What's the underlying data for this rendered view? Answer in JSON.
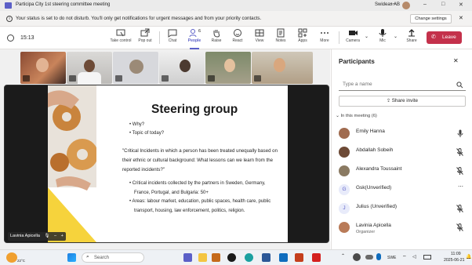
{
  "window": {
    "title": "Participa City 1st steering committee meeting",
    "org": "Swideas AB",
    "controls": [
      "minimize-icon",
      "maximize-icon",
      "close-icon"
    ]
  },
  "banner": {
    "message": "Your status is set to do not disturb. You'll only get notifications for urgent messages and from your priority contacts.",
    "button_label": "Change settings"
  },
  "toolbar": {
    "timer": "15:13",
    "take_control": "Take control",
    "pop_out": "Pop out",
    "chat": "Chat",
    "people": "People",
    "people_count": "6",
    "raise": "Raise",
    "react": "React",
    "view": "View",
    "notes": "Notes",
    "apps": "Apps",
    "more": "More",
    "camera": "Camera",
    "mic": "Mic",
    "share": "Share",
    "leave": "Leave"
  },
  "stage": {
    "presenter_name": "Lavinia Apicella"
  },
  "slide": {
    "title": "Steering group",
    "bullets1": [
      "Why?",
      "Topic of today?"
    ],
    "quote": "\"Critical Incidents in which a person has been treated unequally based on their ethnic or cultural background: What lessons can we learn from the reported incidents?\"",
    "bullets2": [
      "Critical incidents collected by the partners in Sweden, Germany, France, Portugal, and Bulgaria: 50+",
      "Areas: labour market, education, public spaces, health care, public transport, housing, law enforcement, politics, religion."
    ],
    "colors": {
      "accent_yellow": "#f6d33c",
      "text": "#1a1a1a"
    }
  },
  "panel": {
    "title": "Participants",
    "search_placeholder": "Type a name",
    "share_invite": "Share invite",
    "section_label": "In this meeting (6)",
    "participants": [
      {
        "name": "Emily Hanna",
        "role": "",
        "status_icon": "mic-icon"
      },
      {
        "name": "Abdallah Sobeih",
        "role": "",
        "status_icon": "mic-off-icon"
      },
      {
        "name": "Alexandra Toussaint",
        "role": "",
        "status_icon": "mic-off-icon"
      },
      {
        "name": "Gsk(Unverified)",
        "role": "",
        "initials": "G",
        "status_icon": "more-icon"
      },
      {
        "name": "Julius (Unverified)",
        "role": "",
        "initials": "J",
        "status_icon": "mic-off-icon"
      },
      {
        "name": "Lavinia Apicella",
        "role": "Organizer",
        "status_icon": "mic-off-icon"
      }
    ]
  },
  "taskbar": {
    "weather_temp": "22°C",
    "search_placeholder": "Search",
    "language": "SWE",
    "time": "11:09",
    "date": "2025-06-21"
  },
  "colors": {
    "leave_red": "#c4314b",
    "accent": "#5b5fc7"
  }
}
